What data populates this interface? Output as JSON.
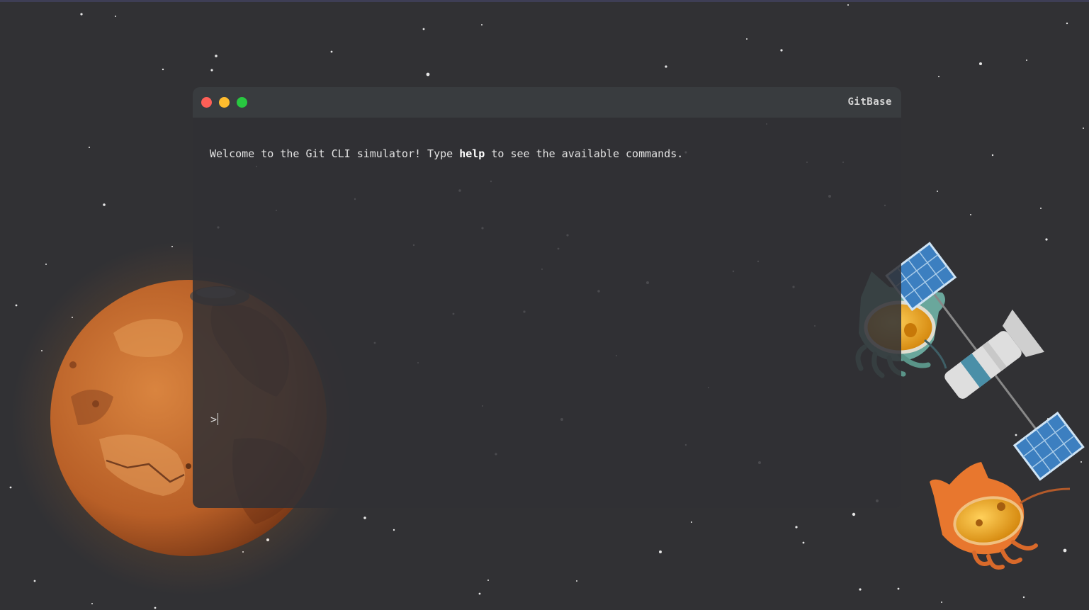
{
  "window": {
    "title": "GitBase"
  },
  "terminal": {
    "welcome_pre": "Welcome to the Git CLI simulator! Type ",
    "welcome_cmd": "help",
    "welcome_post": " to see the available commands.",
    "prompt_symbol": ">",
    "input_value": ""
  },
  "colors": {
    "background": "#313134",
    "titlebar": "#393c3f",
    "dot_close": "#fe5f57",
    "dot_minimize": "#febc2e",
    "dot_maximize": "#28c840",
    "planet": "#c0652c",
    "octocat_teal": "#6aa79c",
    "octocat_orange": "#e8772e"
  },
  "decorations": {
    "planet": "mars-planet",
    "satellite": "satellite-icon",
    "astronauts": [
      "octocat-astronaut-teal",
      "octocat-astronaut-orange"
    ]
  }
}
